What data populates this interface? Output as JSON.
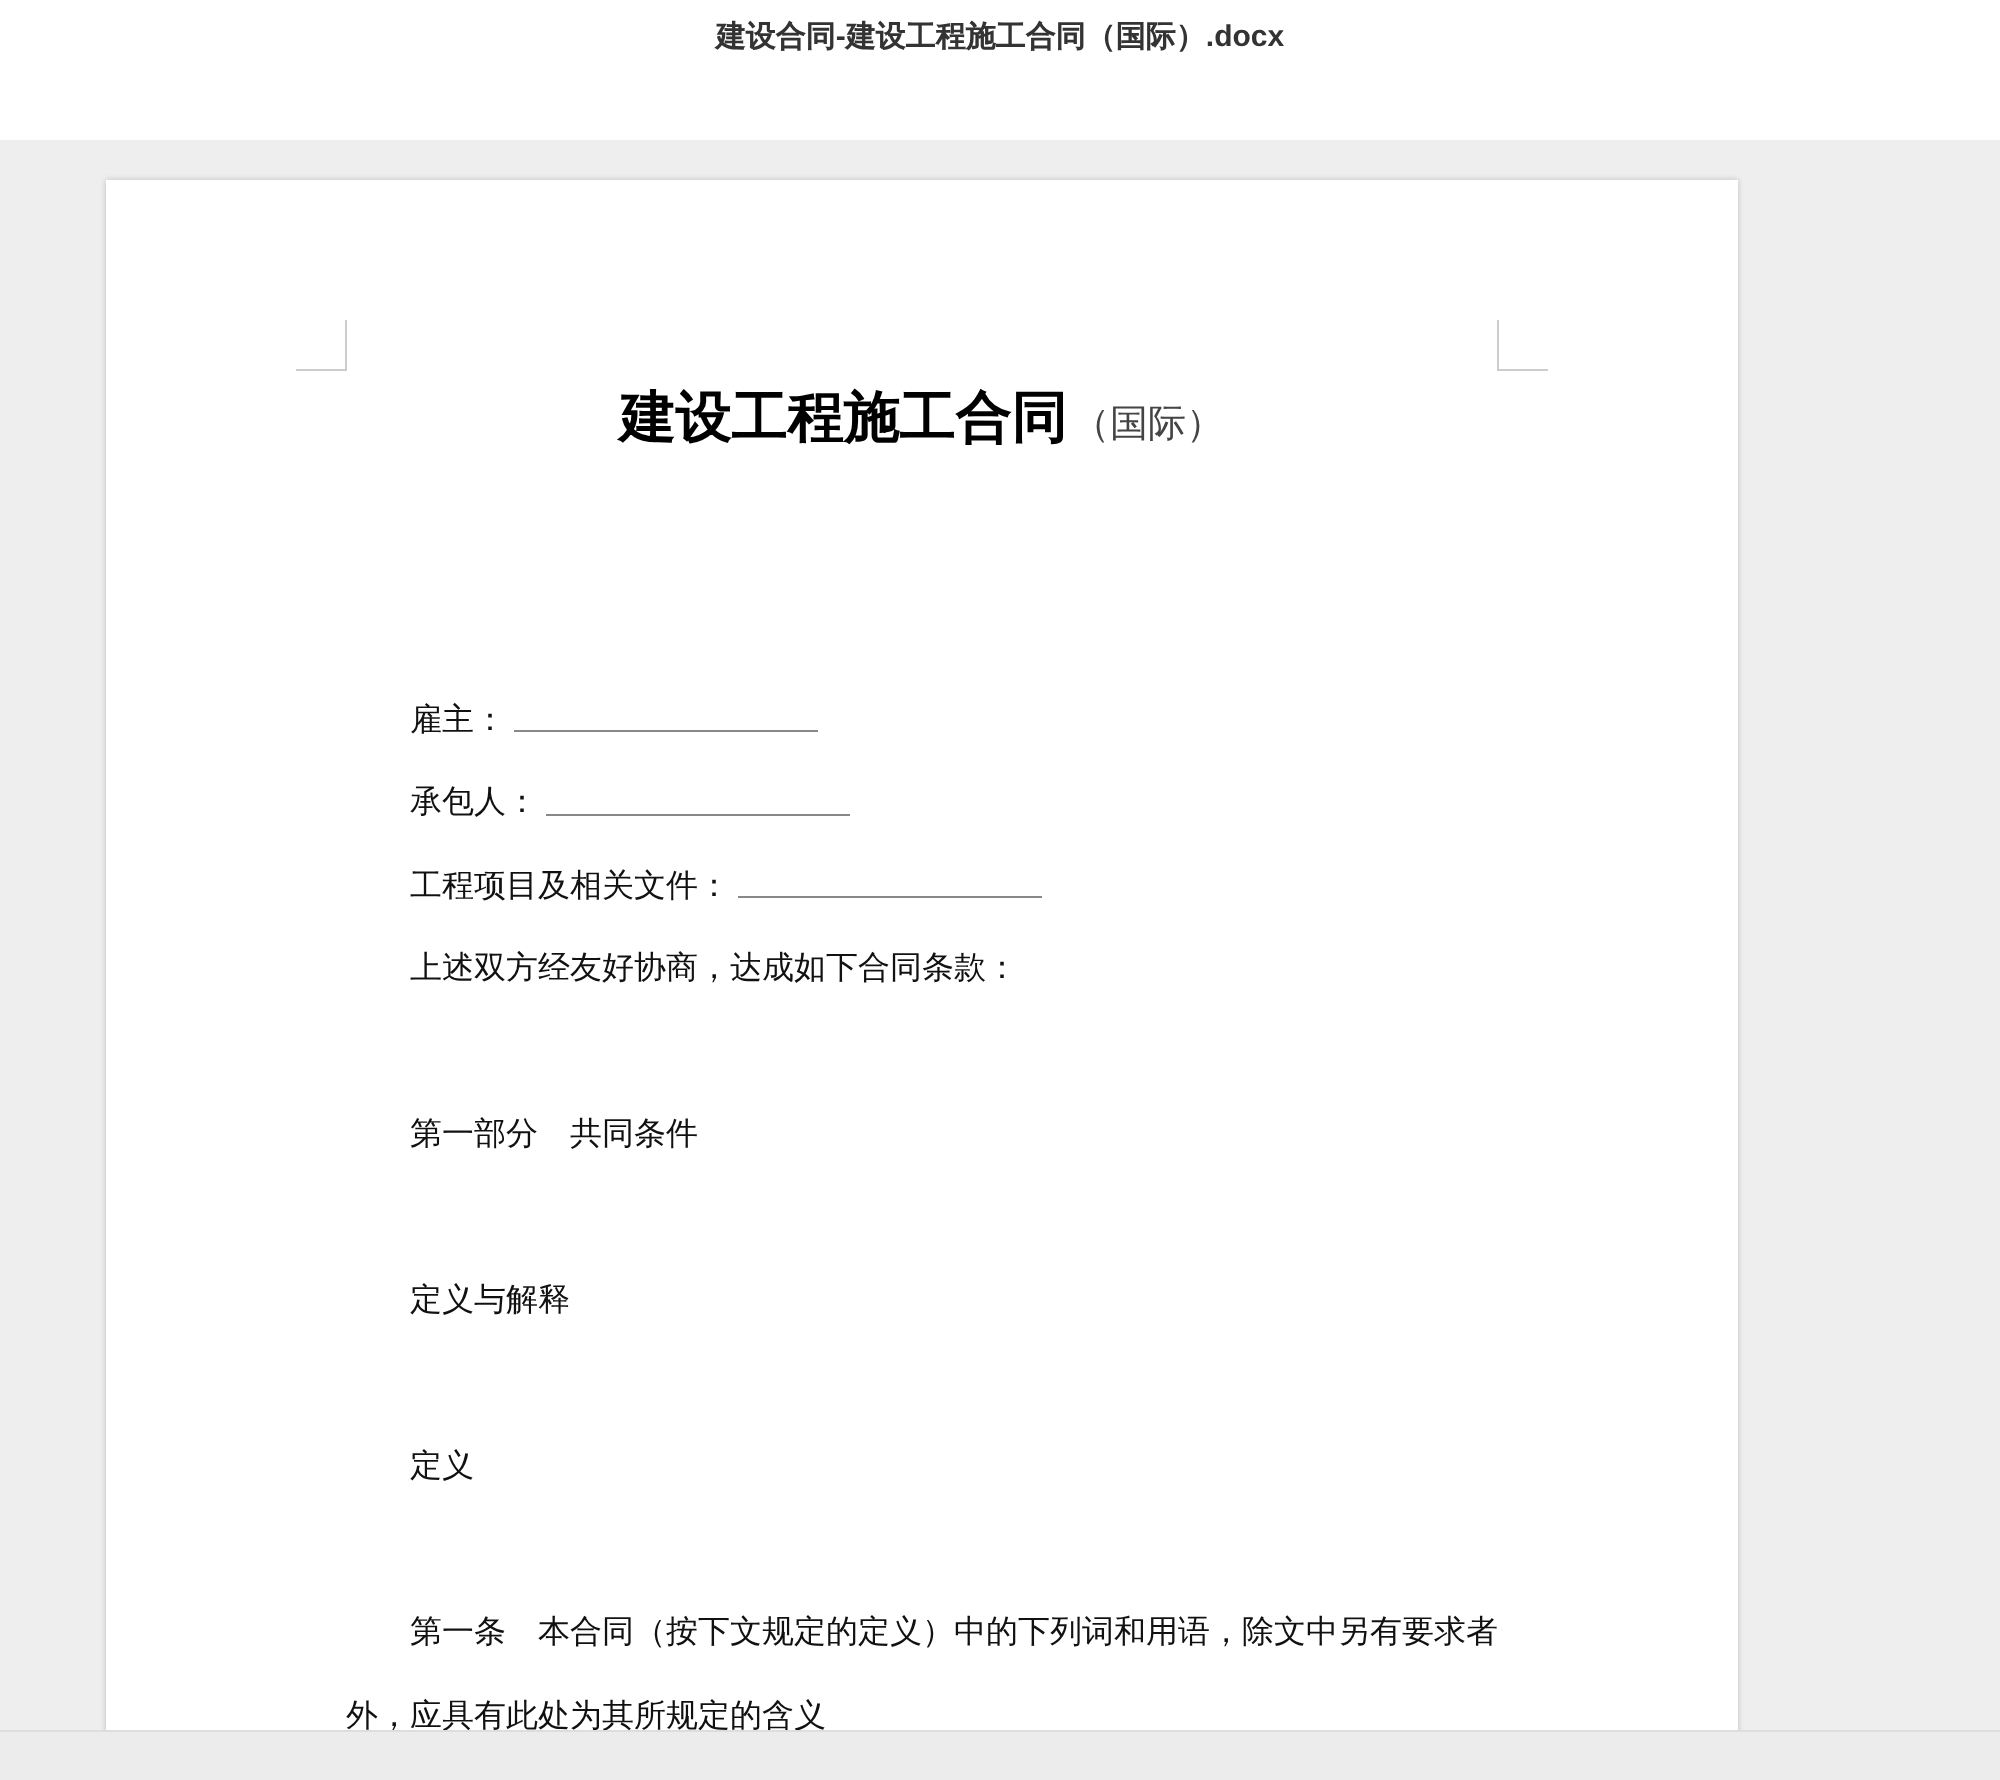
{
  "window": {
    "title": "建设合同-建设工程施工合同（国际）.docx"
  },
  "document": {
    "title": "建设工程施工合同",
    "subtitle": "（国际）",
    "paragraphs": [
      {
        "kind": "field",
        "text": "雇主："
      },
      {
        "kind": "field",
        "text": "承包人："
      },
      {
        "kind": "field",
        "text": "工程项目及相关文件："
      },
      {
        "kind": "text",
        "text": "上述双方经友好协商，达成如下合同条款："
      },
      {
        "kind": "heading",
        "text": "第一部分　共同条件"
      },
      {
        "kind": "heading",
        "text": "定义与解释"
      },
      {
        "kind": "heading",
        "text": "定义"
      },
      {
        "kind": "heading",
        "text": "第一条　本合同（按下文规定的定义）中的下列词和用语，除文中另有要求者外，应具有此处为其所规定的含义"
      }
    ]
  }
}
